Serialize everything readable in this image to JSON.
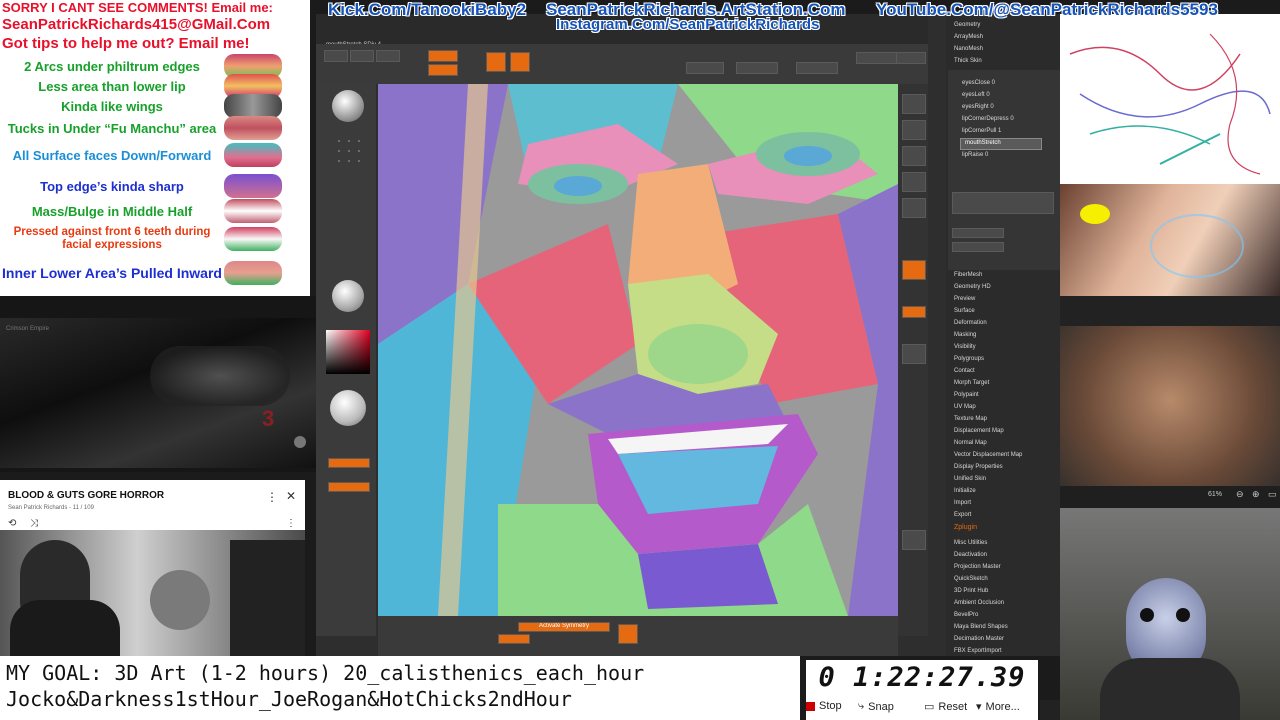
{
  "banner": {
    "line1": "SORRY I CANT SEE COMMENTS! Email me:",
    "line2": "SeanPatrickRichards415@GMail.Com",
    "line3": "Got tips to help me out? Email me!",
    "kick": "Kick.Com/TanookiBaby2",
    "artstation": "SeanPatrickRichards.ArtStation.Com",
    "youtube": "YouTube.Com/@SeanPatrickRichards5593",
    "instagram": "Instagram.Com/SeanPatrickRichards"
  },
  "lips_panel": {
    "rows": [
      {
        "text": "2 Arcs under philtrum edges",
        "color": "#17a12a"
      },
      {
        "text": "Less area than lower lip",
        "color": "#17a12a"
      },
      {
        "text": "Kinda like wings",
        "color": "#17a12a"
      },
      {
        "text": "Tucks in Under “Fu Manchu” area",
        "color": "#17a12a"
      },
      {
        "text": "All Surface faces Down/Forward",
        "color": "#1a8fd8"
      },
      {
        "text": "Top edge’s kinda sharp",
        "color": "#1d2fd0"
      },
      {
        "text": "Mass/Bulge in Middle Half",
        "color": "#17a12a"
      },
      {
        "text": "Pressed against front 6 teeth during facial expressions",
        "color": "#e83a10"
      },
      {
        "text": "Inner Lower Area’s Pulled Inward",
        "color": "#1d2fd0"
      }
    ]
  },
  "video": {
    "watermark": "Crimson Empire",
    "number": "3"
  },
  "playlist": {
    "title": "BLOOD & GUTS GORE HORROR",
    "subtitle": "Sean Patrick Richards - 11 / 109"
  },
  "zbrush": {
    "doc_title": "mouthStretch SDiv 4",
    "menu_top": [
      "Geometry",
      "ArrayMesh",
      "NanoMesh",
      "Thick Skin"
    ],
    "layers": [
      "eyesClose 0",
      "eyesLeft 0",
      "eyesRight 0",
      "lipCornerDepress 0",
      "lipCornerPull 1",
      "mouthStretch",
      "lipRaise 0"
    ],
    "menu_items": [
      "FiberMesh",
      "Geometry HD",
      "Preview",
      "Surface",
      "Deformation",
      "Masking",
      "Visibility",
      "Polygroups",
      "Contact",
      "Morph Target",
      "Polypaint",
      "UV Map",
      "Texture Map",
      "Displacement Map",
      "Normal Map",
      "Vector Displacement Map",
      "Display Properties",
      "Unified Skin",
      "Initialize",
      "Import",
      "Export"
    ],
    "zplugin": "Zplugin",
    "plugin_items": [
      "Misc Utilities",
      "Deactivation",
      "Projection Master",
      "QuickSketch",
      "3D Print Hub",
      "Ambient Occlusion",
      "BevelPro",
      "Maya Blend Shapes",
      "Decimation Master",
      "FBX ExportImport"
    ],
    "bottom_label": "Activate Symmetry"
  },
  "photo_bar": {
    "zoom": "61%"
  },
  "goal": {
    "line1": "MY GOAL: 3D Art (1-2 hours) 20_calisthenics_each_hour",
    "line2": "Jocko&Darkness1stHour_JoeRogan&HotChicks2ndHour"
  },
  "timer": {
    "value": "0 1:22:27.39",
    "stop": "Stop",
    "snap": "Snap",
    "reset": "Reset",
    "more": "More..."
  },
  "colors": {
    "banner_red": "#e8102a",
    "banner_blue": "#1553b8",
    "zbrush_orange": "#e56a10"
  }
}
